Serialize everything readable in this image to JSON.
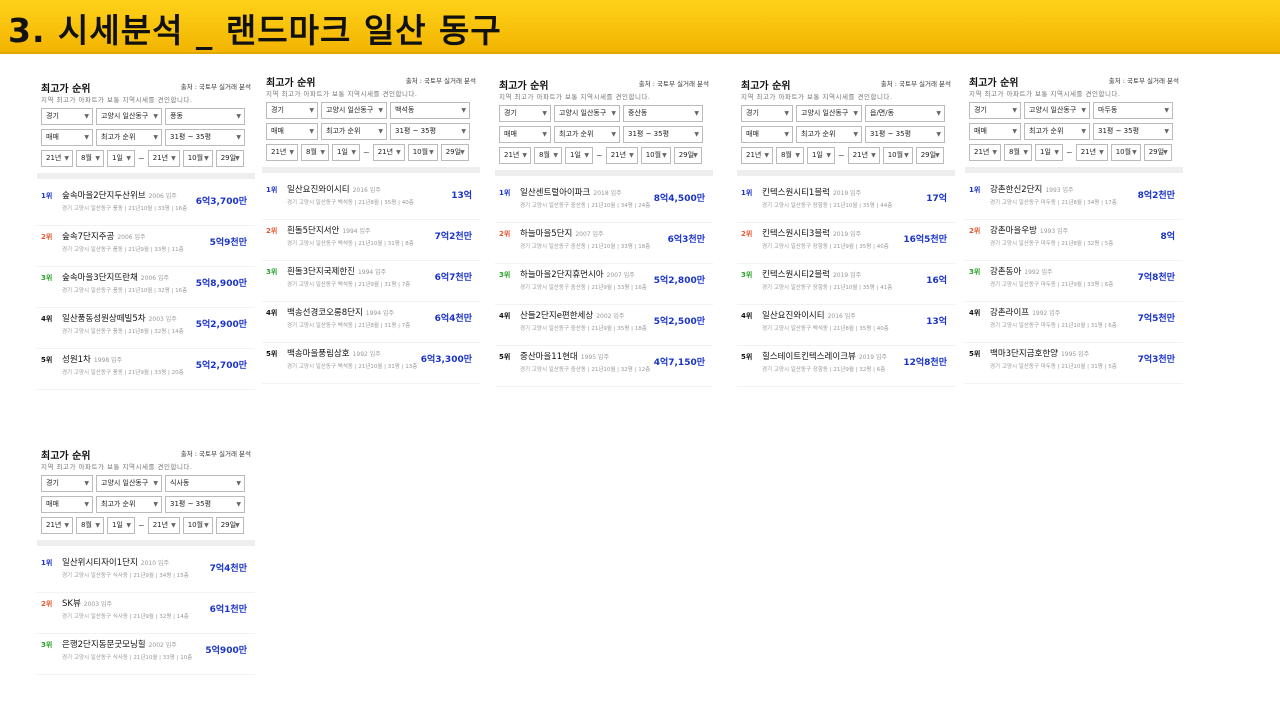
{
  "page": {
    "title": "3. 시세분석 _ 랜드마크 일산 동구"
  },
  "common": {
    "panel_title": "최고가 순위",
    "source": "출처 : 국토부 실거래 분석",
    "description": "지역 최고가 아파트가 보통 지역시세를 견인합니다.",
    "tilde": "~"
  },
  "panels": [
    {
      "filters": {
        "sido": "경기",
        "sigungu": "고양시 일산동구",
        "dong": "풍동",
        "deal": "매매",
        "sort": "최고가 순위",
        "size": "31평 ~ 35평",
        "from_y": "21년",
        "from_m": "8월",
        "from_d": "1일",
        "to_y": "21년",
        "to_m": "10월",
        "to_d": "29일"
      },
      "items": [
        {
          "rank": "1위",
          "name": "숲속마을2단지두산위브",
          "year": "2006 입주",
          "addr": "경기 고양시 일산동구 풍동 | 21년10월 | 33평 | 16층",
          "price": "6억3,700만"
        },
        {
          "rank": "2위",
          "name": "숲속7단지주공",
          "year": "2006 입주",
          "addr": "경기 고양시 일산동구 풍동 | 21년9월 | 33평 | 11층",
          "price": "5억9천만"
        },
        {
          "rank": "3위",
          "name": "숲속마을3단지뜨란채",
          "year": "2006 입주",
          "addr": "경기 고양시 일산동구 풍동 | 21년10월 | 32평 | 16층",
          "price": "5억8,900만"
        },
        {
          "rank": "4위",
          "name": "일산풍동성원상떼빌5차",
          "year": "2003 입주",
          "addr": "경기 고양시 일산동구 풍동 | 21년8월 | 32평 | 14층",
          "price": "5억2,900만"
        },
        {
          "rank": "5위",
          "name": "성원1차",
          "year": "1998 입주",
          "addr": "경기 고양시 일산동구 풍동 | 21년9월 | 33평 | 20층",
          "price": "5억2,700만"
        }
      ]
    },
    {
      "filters": {
        "sido": "경기",
        "sigungu": "고양시 일산동구",
        "dong": "백석동",
        "deal": "매매",
        "sort": "최고가 순위",
        "size": "31평 ~ 35평",
        "from_y": "21년",
        "from_m": "8월",
        "from_d": "1일",
        "to_y": "21년",
        "to_m": "10월",
        "to_d": "29일"
      },
      "items": [
        {
          "rank": "1위",
          "name": "일산요진와이시티",
          "year": "2016 입주",
          "addr": "경기 고양시 일산동구 백석동 | 21년8월 | 35평 | 40층",
          "price": "13억"
        },
        {
          "rank": "2위",
          "name": "흰돌5단지서안",
          "year": "1994 입주",
          "addr": "경기 고양시 일산동구 백석동 | 21년10월 | 31평 | 8층",
          "price": "7억2천만"
        },
        {
          "rank": "3위",
          "name": "흰돌3단지국제한진",
          "year": "1994 입주",
          "addr": "경기 고양시 일산동구 백석동 | 21년9월 | 31평 | 7층",
          "price": "6억7천만"
        },
        {
          "rank": "4위",
          "name": "백송선경코오롱8단지",
          "year": "1994 입주",
          "addr": "경기 고양시 일산동구 백석동 | 21년8월 | 31평 | 7층",
          "price": "6억4천만"
        },
        {
          "rank": "5위",
          "name": "백송마을풍림삼호",
          "year": "1992 입주",
          "addr": "경기 고양시 일산동구 백석동 | 21년10월 | 31평 | 13층",
          "price": "6억3,300만"
        }
      ]
    },
    {
      "filters": {
        "sido": "경기",
        "sigungu": "고양시 일산동구",
        "dong": "중산동",
        "deal": "매매",
        "sort": "최고가 순위",
        "size": "31평 ~ 35평",
        "from_y": "21년",
        "from_m": "8월",
        "from_d": "1일",
        "to_y": "21년",
        "to_m": "10월",
        "to_d": "29일"
      },
      "items": [
        {
          "rank": "1위",
          "name": "일산센트럴아이파크",
          "year": "2018 입주",
          "addr": "경기 고양시 일산동구 중산동 | 21년10월 | 34평 | 24층",
          "price": "8억4,500만"
        },
        {
          "rank": "2위",
          "name": "하늘마을5단지",
          "year": "2007 입주",
          "addr": "경기 고양시 일산동구 중산동 | 21년10월 | 33평 | 18층",
          "price": "6억3천만"
        },
        {
          "rank": "3위",
          "name": "하늘마을2단지휴먼시아",
          "year": "2007 입주",
          "addr": "경기 고양시 일산동구 중산동 | 21년9월 | 33평 | 16층",
          "price": "5억2,800만"
        },
        {
          "rank": "4위",
          "name": "산들2단지e편한세상",
          "year": "2002 입주",
          "addr": "경기 고양시 일산동구 중산동 | 21년9월 | 35평 | 18층",
          "price": "5억2,500만"
        },
        {
          "rank": "5위",
          "name": "중산마을11현대",
          "year": "1995 입주",
          "addr": "경기 고양시 일산동구 중산동 | 21년10월 | 32평 | 12층",
          "price": "4억7,150만"
        }
      ]
    },
    {
      "filters": {
        "sido": "경기",
        "sigungu": "고양시 일산동구",
        "dong": "읍/면/동",
        "deal": "매매",
        "sort": "최고가 순위",
        "size": "31평 ~ 35평",
        "from_y": "21년",
        "from_m": "8월",
        "from_d": "1일",
        "to_y": "21년",
        "to_m": "10월",
        "to_d": "29일"
      },
      "items": [
        {
          "rank": "1위",
          "name": "킨텍스원시티1블럭",
          "year": "2019 입주",
          "addr": "경기 고양시 일산동구 장항동 | 21년10월 | 35평 | 44층",
          "price": "17억"
        },
        {
          "rank": "2위",
          "name": "킨텍스원시티3블럭",
          "year": "2019 입주",
          "addr": "경기 고양시 일산동구 장항동 | 21년9월 | 35평 | 40층",
          "price": "16억5천만"
        },
        {
          "rank": "3위",
          "name": "킨텍스원시티2블럭",
          "year": "2019 입주",
          "addr": "경기 고양시 일산동구 장항동 | 21년10월 | 35평 | 41층",
          "price": "16억"
        },
        {
          "rank": "4위",
          "name": "일산요진와이시티",
          "year": "2016 입주",
          "addr": "경기 고양시 일산동구 백석동 | 21년8월 | 35평 | 40층",
          "price": "13억"
        },
        {
          "rank": "5위",
          "name": "힐스테이트킨텍스레이크뷰",
          "year": "2019 입주",
          "addr": "경기 고양시 일산동구 장항동 | 21년9월 | 32평 | 6층",
          "price": "12억8천만"
        }
      ]
    },
    {
      "filters": {
        "sido": "경기",
        "sigungu": "고양시 일산동구",
        "dong": "마두동",
        "deal": "매매",
        "sort": "최고가 순위",
        "size": "31평 ~ 35평",
        "from_y": "21년",
        "from_m": "8월",
        "from_d": "1일",
        "to_y": "21년",
        "to_m": "10월",
        "to_d": "29일"
      },
      "items": [
        {
          "rank": "1위",
          "name": "강촌한신2단지",
          "year": "1993 입주",
          "addr": "경기 고양시 일산동구 마두동 | 21년8월 | 34평 | 17층",
          "price": "8억2천만"
        },
        {
          "rank": "2위",
          "name": "강촌마을우방",
          "year": "1993 입주",
          "addr": "경기 고양시 일산동구 마두동 | 21년8월 | 32평 | 5층",
          "price": "8억"
        },
        {
          "rank": "3위",
          "name": "강촌동아",
          "year": "1992 입주",
          "addr": "경기 고양시 일산동구 마두동 | 21년9월 | 33평 | 6층",
          "price": "7억8천만"
        },
        {
          "rank": "4위",
          "name": "강촌라이프",
          "year": "1992 입주",
          "addr": "경기 고양시 일산동구 마두동 | 21년10월 | 31평 | 6층",
          "price": "7억5천만"
        },
        {
          "rank": "5위",
          "name": "백마3단지금호한양",
          "year": "1995 입주",
          "addr": "경기 고양시 일산동구 마두동 | 21년10월 | 31평 | 5층",
          "price": "7억3천만"
        }
      ]
    },
    {
      "filters": {
        "sido": "경기",
        "sigungu": "고양시 일산동구",
        "dong": "식사동",
        "deal": "매매",
        "sort": "최고가 순위",
        "size": "31평 ~ 35평",
        "from_y": "21년",
        "from_m": "8월",
        "from_d": "1일",
        "to_y": "21년",
        "to_m": "10월",
        "to_d": "29일"
      },
      "items": [
        {
          "rank": "1위",
          "name": "일산위시티자이1단지",
          "year": "2010 입주",
          "addr": "경기 고양시 일산동구 식사동 | 21년9월 | 34평 | 15층",
          "price": "7억4천만"
        },
        {
          "rank": "2위",
          "name": "SK뷰",
          "year": "2003 입주",
          "addr": "경기 고양시 일산동구 식사동 | 21년9월 | 32평 | 14층",
          "price": "6억1천만"
        },
        {
          "rank": "3위",
          "name": "은행2단지동문굿모닝힐",
          "year": "2002 입주",
          "addr": "경기 고양시 일산동구 식사동 | 21년10월 | 33평 | 10층",
          "price": "5억900만"
        }
      ]
    }
  ]
}
